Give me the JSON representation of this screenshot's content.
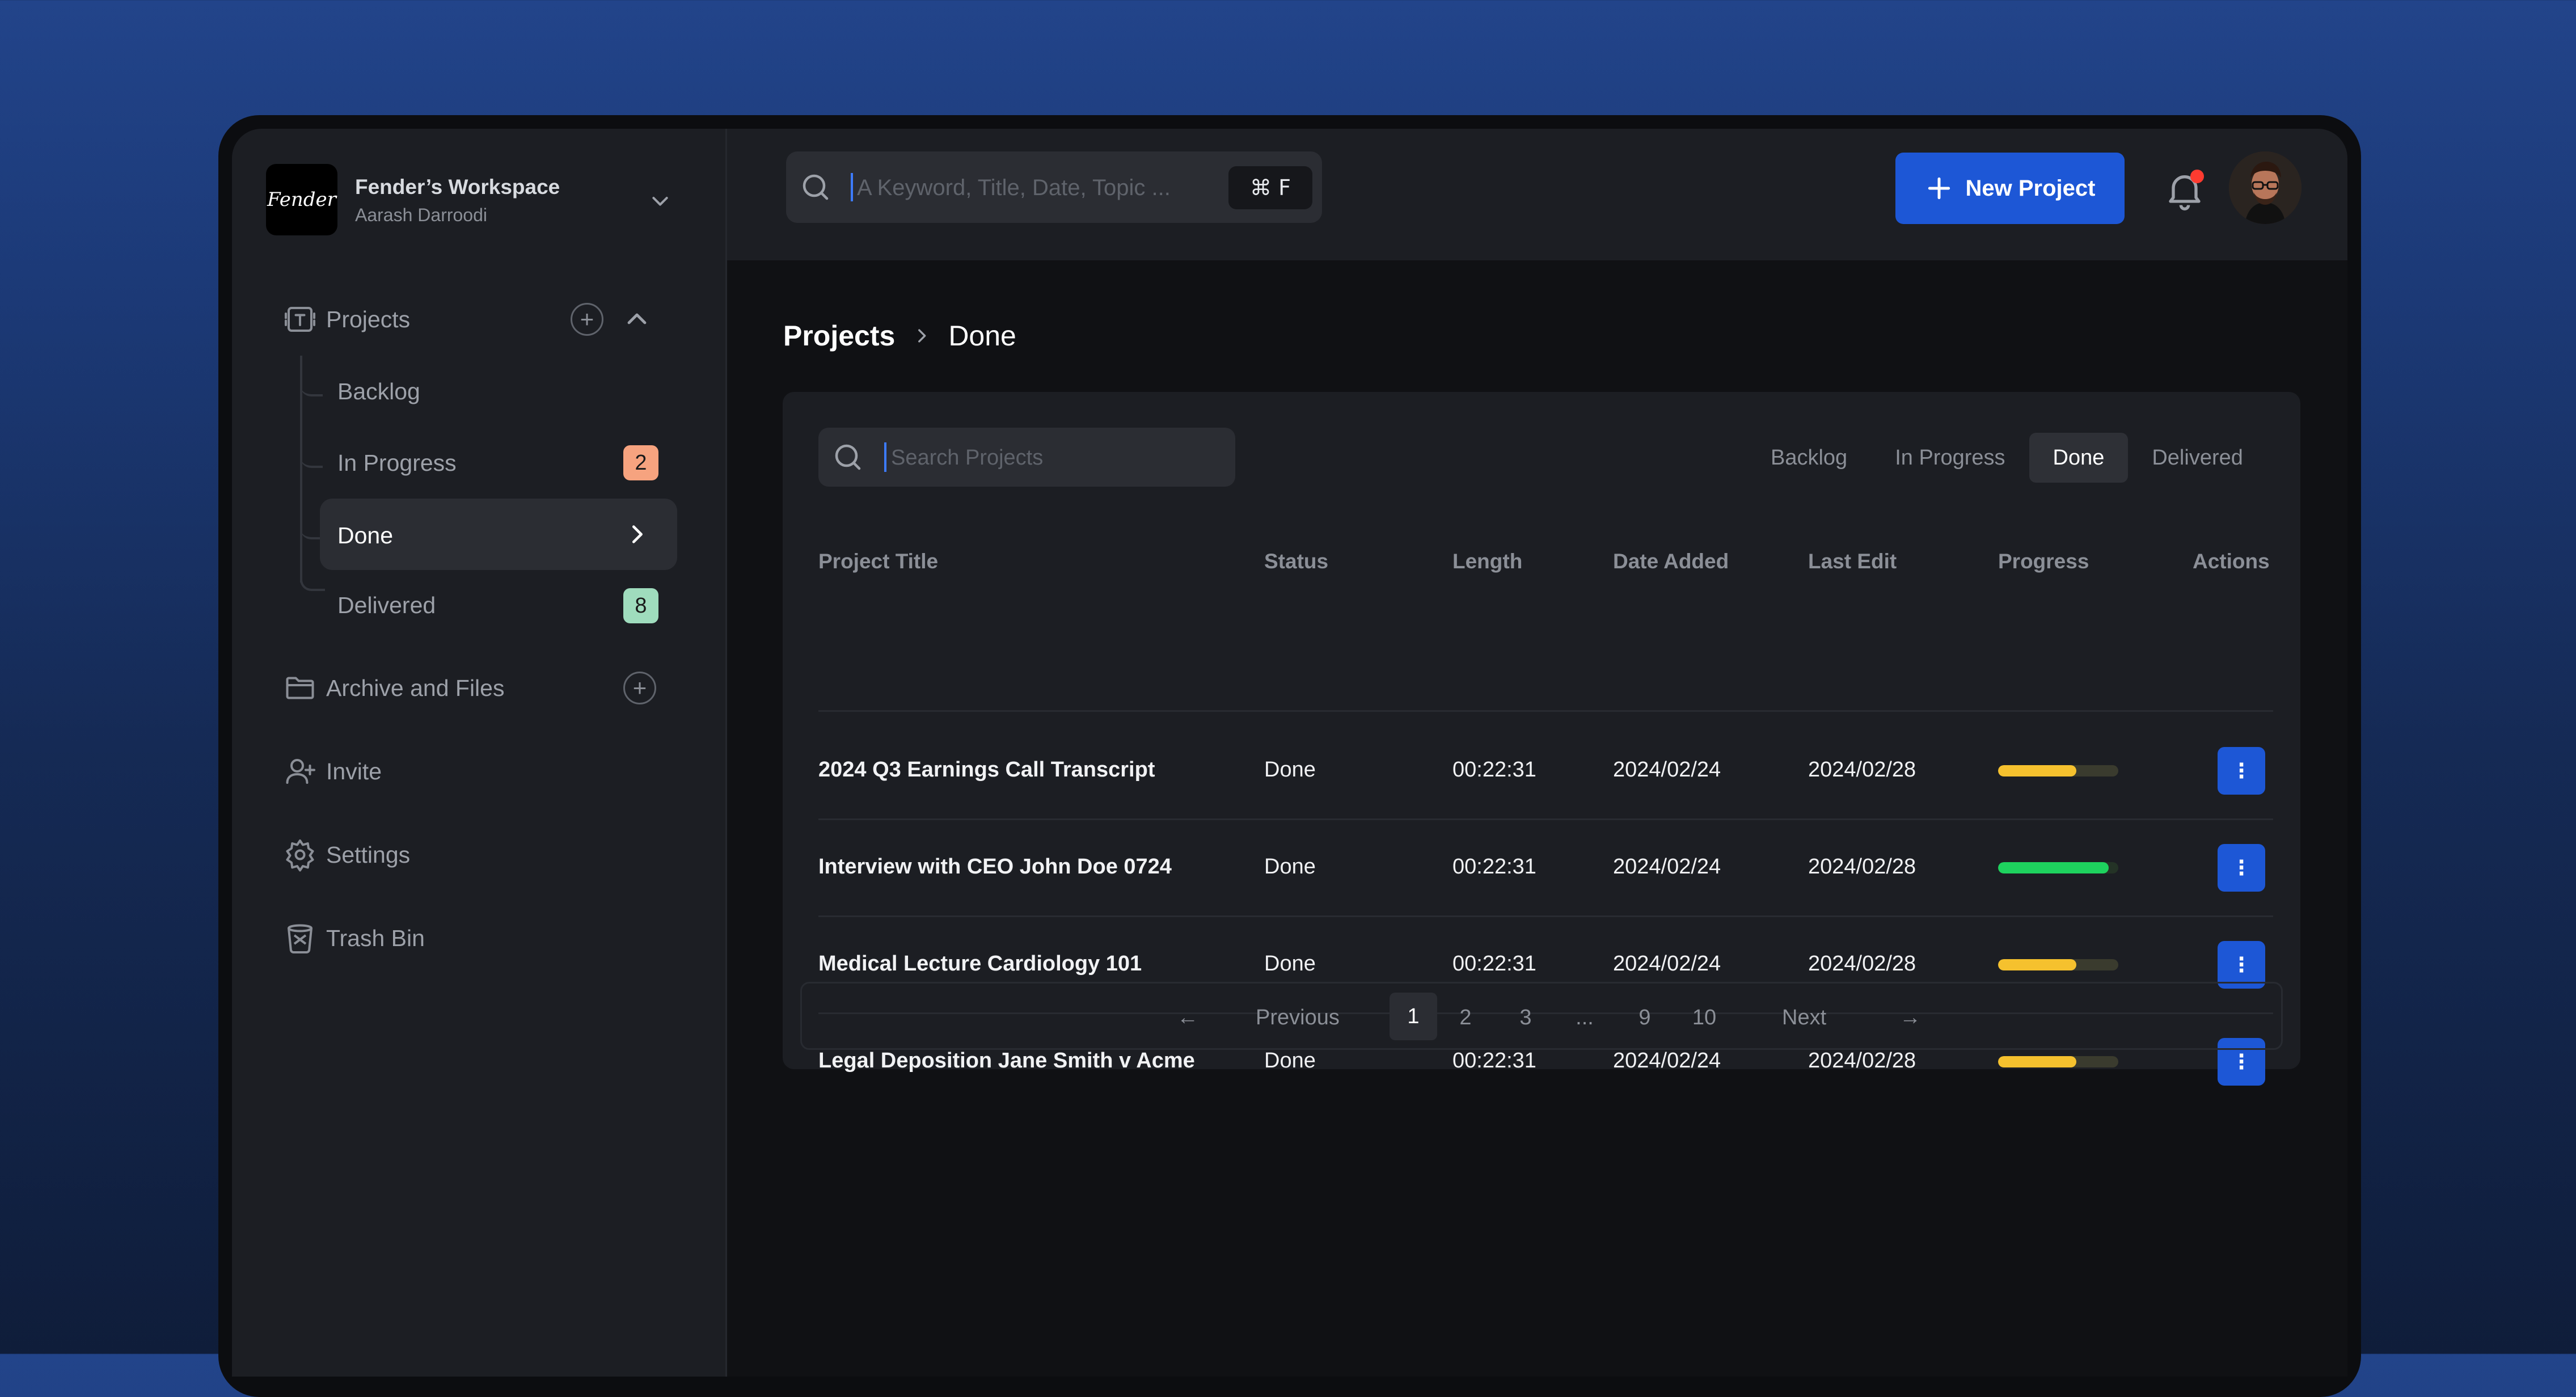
{
  "workspace": {
    "logo_text": "Fender",
    "name": "Fender’s Workspace",
    "user": "Aarash Darroodi"
  },
  "sidebar": {
    "projects_label": "Projects",
    "sub_items": [
      {
        "label": "Backlog",
        "badge": ""
      },
      {
        "label": "In Progress",
        "badge": "2",
        "badge_color": "#f6a37f"
      },
      {
        "label": "Done",
        "badge": ""
      },
      {
        "label": "Delivered",
        "badge": "8",
        "badge_color": "#9fdcbd"
      }
    ],
    "archive_label": "Archive and Files",
    "invite_label": "Invite",
    "settings_label": "Settings",
    "trash_label": "Trash Bin"
  },
  "topbar": {
    "search_placeholder": "A Keyword, Title, Date, Topic ...",
    "shortcut": "⌘ F",
    "new_project_label": "New Project",
    "notification_dot_color": "#ff3b30"
  },
  "breadcrumb": {
    "root": "Projects",
    "current": "Done"
  },
  "table_card": {
    "search_placeholder": "Search Projects",
    "filters": [
      {
        "label": "Backlog",
        "active": false
      },
      {
        "label": "In Progress",
        "active": false
      },
      {
        "label": "Done",
        "active": true
      },
      {
        "label": "Delivered",
        "active": false
      }
    ],
    "columns": [
      "Project Title",
      "Status",
      "Length",
      "Date Added",
      "Last Edit",
      "Progress",
      "Actions"
    ],
    "rows": [
      {
        "title": "2024 Q3 Earnings Call Transcript",
        "status": "Done",
        "length": "00:22:31",
        "date_added": "2024/02/24",
        "last_edit": "2024/02/28",
        "progress": 0.65,
        "progress_color": "#f5c12e"
      },
      {
        "title": "Interview with CEO John Doe 0724",
        "status": "Done",
        "length": "00:22:31",
        "date_added": "2024/02/24",
        "last_edit": "2024/02/28",
        "progress": 0.92,
        "progress_color": "#1ed25e"
      },
      {
        "title": "Medical Lecture Cardiology 101",
        "status": "Done",
        "length": "00:22:31",
        "date_added": "2024/02/24",
        "last_edit": "2024/02/28",
        "progress": 0.65,
        "progress_color": "#f5c12e"
      },
      {
        "title": "Legal Deposition Jane Smith v Acme",
        "status": "Done",
        "length": "00:22:31",
        "date_added": "2024/02/24",
        "last_edit": "2024/02/28",
        "progress": 0.65,
        "progress_color": "#f5c12e"
      }
    ],
    "actions_glyph": "⋮"
  },
  "pagination": {
    "prev_arrow": "←",
    "previous": "Previous",
    "pages": [
      "1",
      "2",
      "3",
      "...",
      "9",
      "10"
    ],
    "current_page": "1",
    "next": "Next",
    "next_arrow": "→"
  },
  "colors": {
    "accent": "#1d57d6",
    "sidebar_bg": "#1c1e23",
    "content_bg": "#101114"
  }
}
